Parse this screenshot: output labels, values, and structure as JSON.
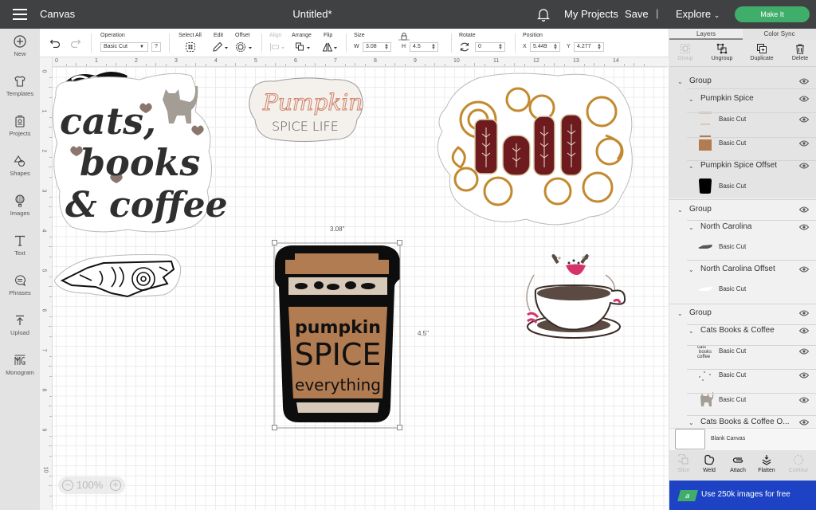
{
  "topbar": {
    "app_label": "Canvas",
    "doc_title": "Untitled*",
    "my_projects": "My Projects",
    "save": "Save",
    "separator": "|",
    "explore": "Explore",
    "make_it": "Make It",
    "make_it_color": "#3fae6b"
  },
  "sidebar": {
    "items": [
      {
        "label": "New",
        "icon": "plus-circle-icon"
      },
      {
        "label": "Templates",
        "icon": "shirt-icon"
      },
      {
        "label": "Projects",
        "icon": "projects-icon"
      },
      {
        "label": "Shapes",
        "icon": "shapes-icon"
      },
      {
        "label": "Images",
        "icon": "balloon-icon"
      },
      {
        "label": "Text",
        "icon": "text-icon"
      },
      {
        "label": "Phrases",
        "icon": "speech-bubble-icon"
      },
      {
        "label": "Upload",
        "icon": "upload-icon"
      },
      {
        "label": "Monogram",
        "icon": "monogram-icon"
      }
    ]
  },
  "toolbar": {
    "operation_label": "Operation",
    "operation_value": "Basic Cut",
    "help": "?",
    "select_all": "Select All",
    "edit": "Edit",
    "offset": "Offset",
    "align": "Align",
    "arrange": "Arrange",
    "flip": "Flip",
    "size_label": "Size",
    "w_label": "W",
    "w_value": "3.08",
    "h_label": "H",
    "h_value": "4.5",
    "rotate_label": "Rotate",
    "rotate_value": "0",
    "position_label": "Position",
    "x_label": "X",
    "x_value": "5.449",
    "y_label": "Y",
    "y_value": "4.277"
  },
  "rulers": {
    "top": [
      "0",
      "1",
      "2",
      "3",
      "4",
      "5",
      "6",
      "7",
      "8",
      "9",
      "10",
      "11",
      "12",
      "13",
      "14"
    ],
    "left": [
      "0",
      "1",
      "2",
      "3",
      "4",
      "5",
      "6",
      "7",
      "8",
      "9",
      "10"
    ]
  },
  "canvas": {
    "selection_width": "3.08\"",
    "selection_height": "4.5\"",
    "zoom": "100%",
    "designs": {
      "cats": {
        "line1": "cats,",
        "line2": "books",
        "line3": "& coffee"
      },
      "pumpkin_life": {
        "line1": "Pumpkin",
        "line2": "SPICE LIFE"
      },
      "fall": {
        "text": "fall"
      },
      "cup": {
        "line1": "pumpkin",
        "line2": "SPICE",
        "line3": "everything"
      }
    }
  },
  "panel": {
    "tabs": [
      "Layers",
      "Color Sync"
    ],
    "tools": [
      "Group",
      "Ungroup",
      "Duplicate",
      "Delete"
    ],
    "layers": [
      {
        "label": "Group"
      },
      {
        "label": "Pumpkin Spice"
      },
      {
        "label": "Basic Cut"
      },
      {
        "label": "Basic Cut"
      },
      {
        "label": "Pumpkin Spice Offset"
      },
      {
        "label": "Basic Cut"
      },
      {
        "label": "Group"
      },
      {
        "label": "North Carolina"
      },
      {
        "label": "Basic Cut"
      },
      {
        "label": "North Carolina Offset"
      },
      {
        "label": "Basic Cut"
      },
      {
        "label": "Group"
      },
      {
        "label": "Cats Books & Coffee"
      },
      {
        "label": "Basic Cut"
      },
      {
        "label": "Basic Cut"
      },
      {
        "label": "Basic Cut"
      },
      {
        "label": "Cats Books & Coffee O..."
      }
    ],
    "blank_canvas": "Blank Canvas",
    "bottom_tools": [
      "Slice",
      "Weld",
      "Attach",
      "Flatten",
      "Contour"
    ],
    "promo": "Use 250k images for free",
    "promo_badge": "a",
    "promo_color": "#1d43c4"
  }
}
